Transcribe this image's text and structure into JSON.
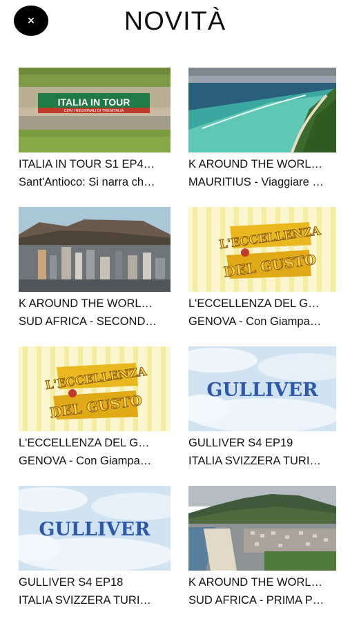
{
  "header": {
    "title": "NOVITÀ",
    "close_label": "×"
  },
  "items": [
    {
      "title": "ITALIA IN TOUR S1 EP4…",
      "subtitle": "Sant'Antioco: Si narra ch…",
      "thumb_text": "ITALIA IN TOUR",
      "thumb_subtext": "CON I REGIONALI DI TRENITALIA"
    },
    {
      "title": "K AROUND THE WORL…",
      "subtitle": "MAURITIUS - Viaggiare …"
    },
    {
      "title": "K AROUND THE WORL…",
      "subtitle": "SUD AFRICA - SECOND…"
    },
    {
      "title": "L'ECCELLENZA DEL G…",
      "subtitle": "GENOVA - Con Giampa…",
      "thumb_text_top": "L'ECCELLENZA",
      "thumb_text_bottom": "DEL GUSTO"
    },
    {
      "title": "L'ECCELLENZA DEL G…",
      "subtitle": "GENOVA - Con Giampa…",
      "thumb_text_top": "L'ECCELLENZA",
      "thumb_text_bottom": "DEL GUSTO"
    },
    {
      "title": "GULLIVER S4 EP19",
      "subtitle": "ITALIA SVIZZERA TURI…",
      "thumb_text": "GULLIVER"
    },
    {
      "title": "GULLIVER S4 EP18",
      "subtitle": "ITALIA SVIZZERA TURI…",
      "thumb_text": "GULLIVER"
    },
    {
      "title": "K AROUND THE WORL…",
      "subtitle": "SUD AFRICA - PRIMA P…"
    }
  ]
}
